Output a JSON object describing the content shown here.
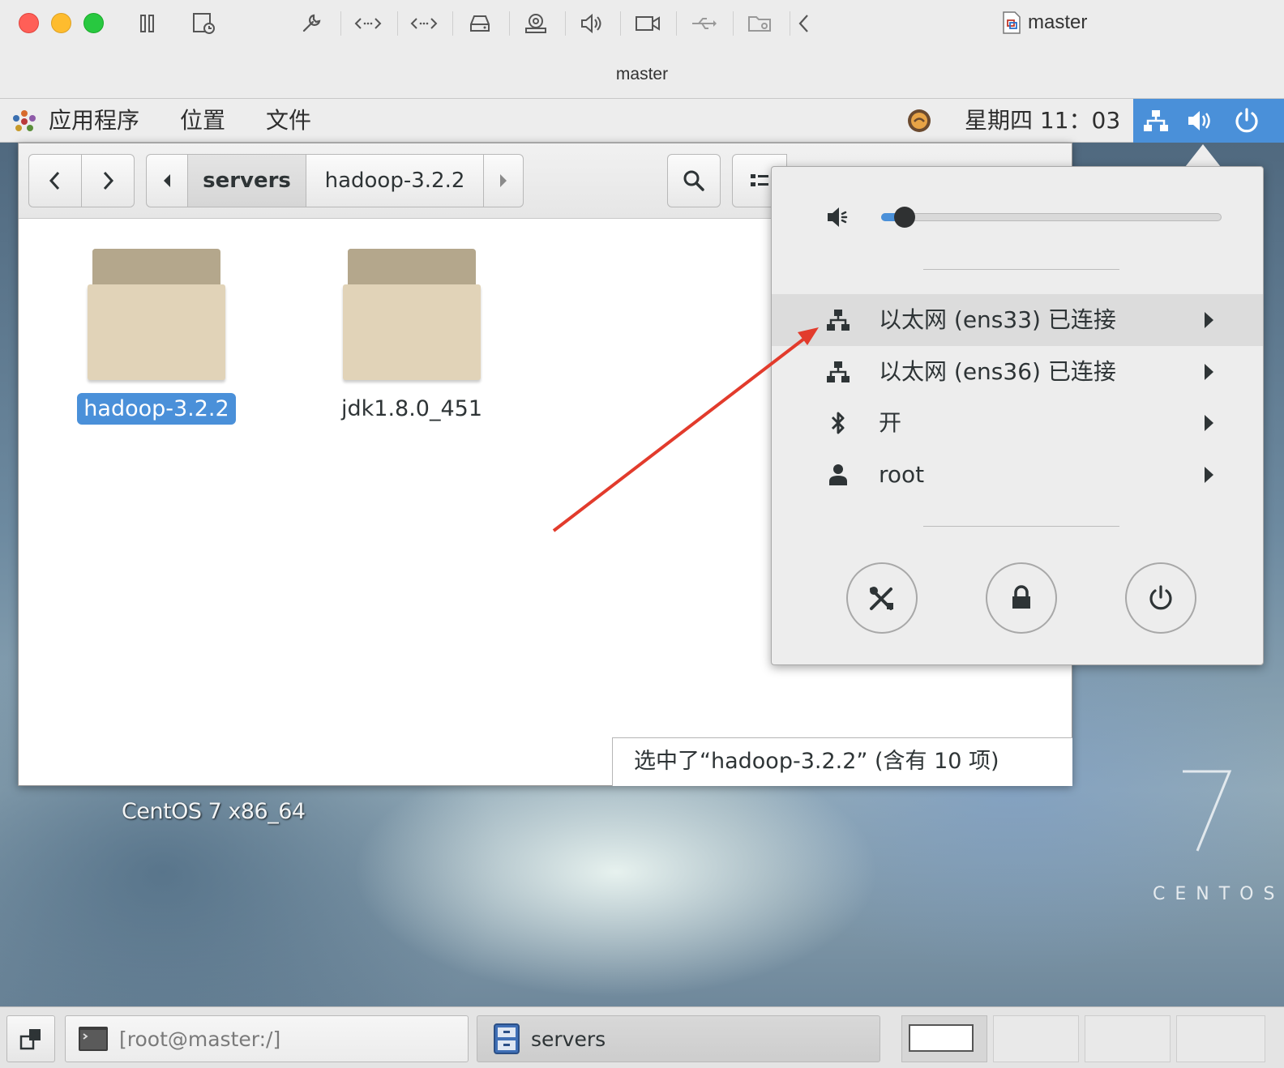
{
  "mac": {
    "doc_title": "master",
    "window_title": "master",
    "tools": [
      "pause-icon",
      "snapshot-icon",
      "wrench-icon",
      "code-arrows-icon",
      "code-arrows-icon",
      "disk-icon",
      "camera-icon",
      "speaker-icon",
      "video-icon",
      "usb-icon",
      "folder-share-icon",
      "chevron-left-icon"
    ]
  },
  "topbar": {
    "menu_apps": "应用程序",
    "menu_places": "位置",
    "menu_files": "文件",
    "clock": "星期四 11：03",
    "accent": "#4a90d9"
  },
  "file_manager": {
    "crumbs": [
      "servers",
      "hadoop-3.2.2"
    ],
    "items": [
      {
        "name": "hadoop-3.2.2",
        "selected": true
      },
      {
        "name": "jdk1.8.0_451",
        "selected": false
      }
    ],
    "status": "选中了“hadoop-3.2.2” (含有 10 项)"
  },
  "system_menu": {
    "volume_level": 0.07,
    "rows": [
      {
        "label": "以太网 (ens33) 已连接",
        "icon": "network-icon"
      },
      {
        "label": "以太网 (ens36) 已连接",
        "icon": "network-icon"
      },
      {
        "label": "开",
        "icon": "bluetooth-icon"
      },
      {
        "label": "root",
        "icon": "user-icon"
      }
    ]
  },
  "desktop": {
    "label": "CentOS 7 x86_64",
    "brand_word": "CENTOS"
  },
  "taskbar": {
    "terminal_label": "[root@master:/]",
    "files_label": "servers"
  }
}
